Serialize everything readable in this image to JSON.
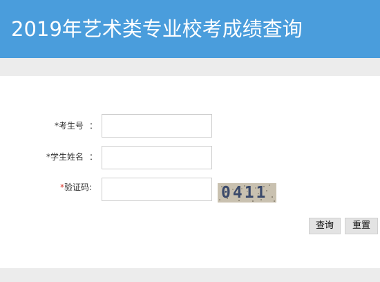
{
  "header": {
    "title": "2019年艺术类专业校考成绩查询"
  },
  "form": {
    "exam_number": {
      "asterisk": "*",
      "label": "考生号",
      "colon": "：",
      "value": ""
    },
    "student_name": {
      "asterisk": "*",
      "label": "学生姓名",
      "colon": "：",
      "value": ""
    },
    "captcha": {
      "asterisk": "*",
      "label": "验证码:",
      "value": "",
      "image_text": "0411"
    }
  },
  "buttons": {
    "query_label": "查询",
    "reset_label": "重置"
  },
  "colors": {
    "header_bg": "#4a9ddc",
    "band_bg": "#ececec",
    "required_red": "#d9362b"
  }
}
